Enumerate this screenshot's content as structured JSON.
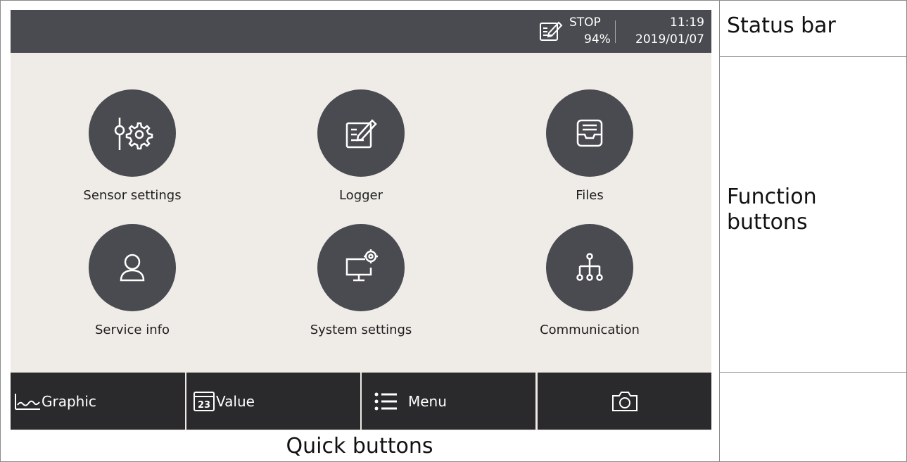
{
  "status_bar": {
    "icon": "logger-edit-icon",
    "mode": "STOP",
    "battery": "94%",
    "time": "11:19",
    "date": "2019/01/07"
  },
  "functions": [
    {
      "label": "Sensor settings",
      "icon": "sensor-settings-icon"
    },
    {
      "label": "Logger",
      "icon": "logger-icon"
    },
    {
      "label": "Files",
      "icon": "files-tray-icon"
    },
    {
      "label": "Service info",
      "icon": "user-icon"
    },
    {
      "label": "System settings",
      "icon": "monitor-gear-icon"
    },
    {
      "label": "Communication",
      "icon": "network-icon"
    }
  ],
  "quick_buttons": [
    {
      "label": "Graphic",
      "icon": "graph-icon"
    },
    {
      "label": "Value",
      "icon": "calendar-23-icon",
      "icon_text": "23"
    },
    {
      "label": "Menu",
      "icon": "list-icon"
    },
    {
      "label": "",
      "icon": "camera-icon"
    }
  ],
  "captions": {
    "status_bar": "Status bar",
    "function_buttons": "Function buttons",
    "quick_buttons": "Quick buttons"
  },
  "colors": {
    "status_bar_bg": "#4a4b50",
    "screen_bg": "#efece8",
    "circle_bg": "#4a4b50",
    "quick_bar_bg": "#2a2a2c"
  }
}
